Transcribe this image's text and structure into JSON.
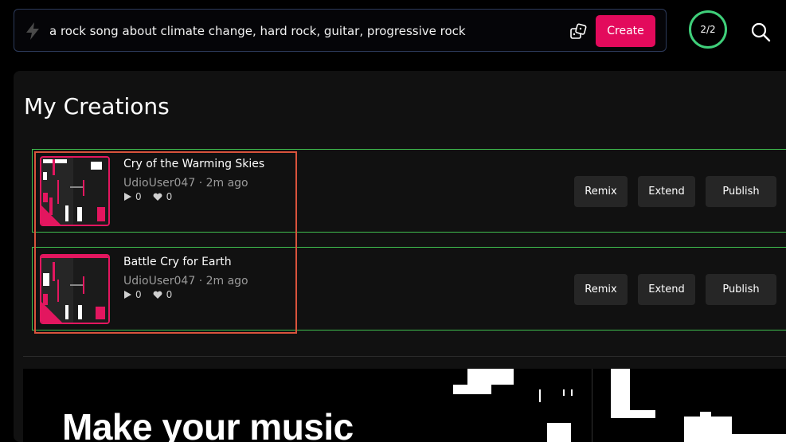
{
  "prompt": {
    "text": "a rock song about climate change, hard rock, guitar, progressive rock",
    "create_label": "Create"
  },
  "credits": "2/2",
  "page_title": "My Creations",
  "songs": [
    {
      "title": "Cry of the Warming Skies",
      "user": "UdioUser047",
      "time": "2m ago",
      "plays": "0",
      "likes": "0",
      "remix": "Remix",
      "extend": "Extend",
      "publish": "Publish"
    },
    {
      "title": "Battle Cry for Earth",
      "user": "UdioUser047",
      "time": "2m ago",
      "plays": "0",
      "likes": "0",
      "remix": "Remix",
      "extend": "Extend",
      "publish": "Publish"
    }
  ],
  "banner_text": "Make your music",
  "colors": {
    "accent": "#e30a5c",
    "credits_ring": "#3fcf7a",
    "panel_bg": "#111111",
    "button_bg": "#262626"
  },
  "icons": [
    "bolt-icon",
    "dice-icon",
    "search-icon",
    "play-icon",
    "heart-icon"
  ]
}
